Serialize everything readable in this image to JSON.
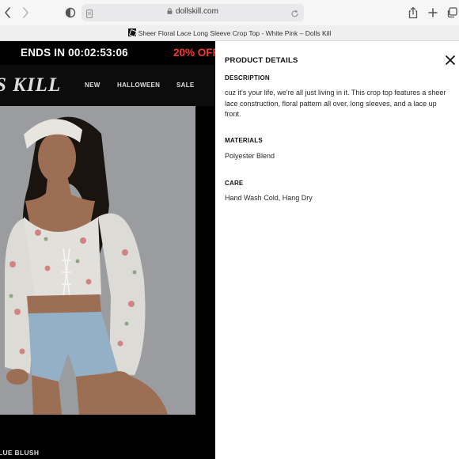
{
  "browser": {
    "url_domain": "dollskill.com",
    "tab_title": "Sheer Floral Lace Long Sleeve Crop Top - White Pink – Dolls Kill",
    "icons": [
      "back-icon",
      "forward-icon",
      "sidebar-icon",
      "document-icon",
      "lock-icon",
      "reload-icon",
      "share-icon",
      "new-tab-icon",
      "tabs-overview-icon"
    ]
  },
  "promo": {
    "ends_in": "ENDS IN  00:02:53:06",
    "sale": "20% OFF"
  },
  "site_nav": {
    "logo": "S KILL",
    "links": [
      "NEW",
      "HALLOWEEN",
      "SALE"
    ]
  },
  "product": {
    "color_label": "LUE BLUSH"
  },
  "drawer": {
    "title": "PRODUCT DETAILS",
    "sections": [
      {
        "heading": "DESCRIPTION",
        "body": "cuz it's your life, we're all just living in it. This crop top features a sheer lace construction, floral pattern all over, long sleeves, and a lace up front."
      },
      {
        "heading": "MATERIALS",
        "body": "Polyester Blend"
      },
      {
        "heading": "CARE",
        "body": "Hand Wash Cold, Hang Dry"
      }
    ]
  },
  "colors": {
    "promo_sale": "#ff3b30",
    "page_bg": "#000000",
    "drawer_bg": "#ffffff",
    "photo_bg": "#a2a3a7"
  }
}
